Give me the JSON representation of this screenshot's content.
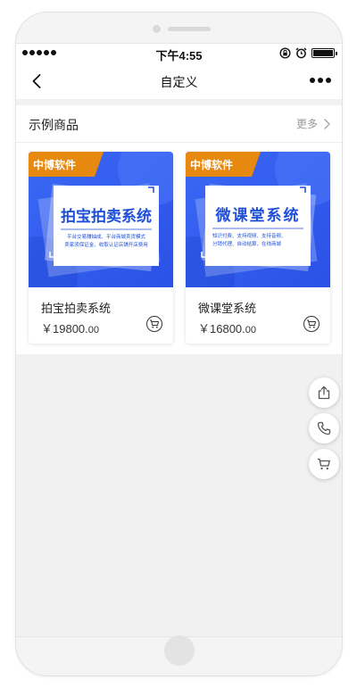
{
  "status_bar": {
    "time": "下午4:55",
    "icons": [
      "signal-dots-icon",
      "orientation-lock-icon",
      "alarm-icon",
      "battery-icon"
    ]
  },
  "navbar": {
    "title": "自定义",
    "back_icon": "chevron-left-icon",
    "more_icon": "ellipsis-icon"
  },
  "section": {
    "title": "示例商品",
    "more_label": "更多",
    "more_icon": "chevron-right-icon"
  },
  "products": [
    {
      "name": "拍宝拍卖系统",
      "price_currency": "￥",
      "price_main": "19800.",
      "price_cents": "00",
      "image": {
        "brand_tag": "中博软件",
        "headline": "拍宝拍卖系统",
        "desc_line1": "平台交易赚抽成、平台商城卖货模式",
        "desc_line2": "卖家须保证金、收取认证店铺开店费用"
      },
      "cart_icon": "cart-icon"
    },
    {
      "name": "微课堂系统",
      "price_currency": "￥",
      "price_main": "16800.",
      "price_cents": "00",
      "image": {
        "brand_tag": "中博软件",
        "headline": "微课堂系统",
        "desc_line1": "知识付费、支持视频、支持音频、",
        "desc_line2": "分销代理、自动结算、在线商城"
      },
      "cart_icon": "cart-icon"
    }
  ],
  "floating_actions": [
    "share-icon",
    "phone-icon",
    "cart-icon"
  ],
  "colors": {
    "banner_blue": "#2f5ef0",
    "banner_blue_light": "#5b87ff",
    "brand_tag_orange": "#e8890f",
    "headline_blue": "#1f4fd8",
    "screen_bg": "#f1f1f1"
  }
}
